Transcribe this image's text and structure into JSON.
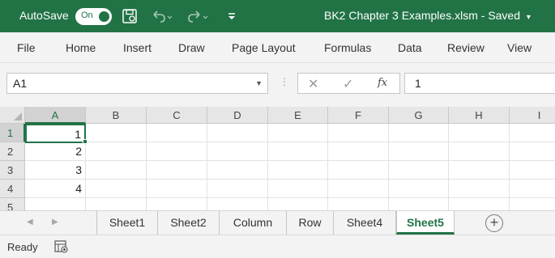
{
  "titlebar": {
    "autosave_label": "AutoSave",
    "toggle_state": "On",
    "filename": "BK2 Chapter 3 Examples.xlsm",
    "separator": "-",
    "save_status": "Saved",
    "bg_color": "#217346"
  },
  "menu": {
    "items": [
      "File",
      "Home",
      "Insert",
      "Draw",
      "Page Layout",
      "Formulas",
      "Data",
      "Review",
      "View"
    ]
  },
  "formula_bar": {
    "name_box": "A1",
    "fx_label": "fx",
    "formula_value": "1"
  },
  "grid": {
    "columns": [
      "A",
      "B",
      "C",
      "D",
      "E",
      "F",
      "G",
      "H",
      "I"
    ],
    "rows": [
      "1",
      "2",
      "3",
      "4",
      "5"
    ],
    "cells_column_a": [
      "1",
      "2",
      "3",
      "4",
      ""
    ],
    "active_cell": "A1"
  },
  "sheets": {
    "tabs": [
      "Sheet1",
      "Sheet2",
      "Column",
      "Row",
      "Sheet4",
      "Sheet5"
    ],
    "active_tab": "Sheet5",
    "add_label": "+"
  },
  "status": {
    "ready_label": "Ready"
  }
}
